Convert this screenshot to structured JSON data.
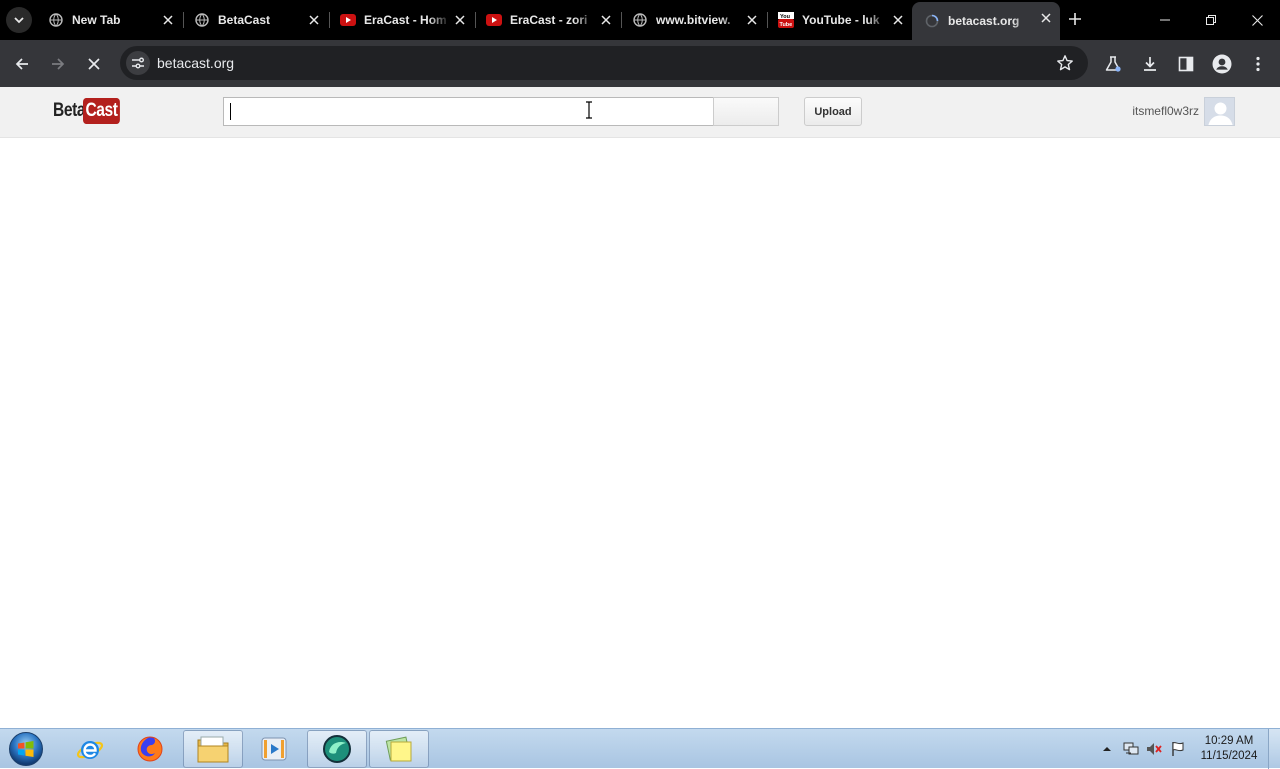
{
  "browser": {
    "tabs": [
      {
        "title": "New Tab",
        "favicon": "globe-icon"
      },
      {
        "title": "BetaCast",
        "favicon": "globe-icon"
      },
      {
        "title": "EraCast - Hom",
        "favicon": "youtube-play-icon"
      },
      {
        "title": "EraCast - zori",
        "favicon": "youtube-play-icon"
      },
      {
        "title": "www.bitview.",
        "favicon": "globe-icon"
      },
      {
        "title": "YouTube - luk",
        "favicon": "youtube-classic-icon"
      },
      {
        "title": "betacast.org",
        "favicon": "loading-icon",
        "active": true
      }
    ],
    "url": "betacast.org"
  },
  "site": {
    "logo_beta": "Beta",
    "logo_cast": "Cast",
    "search_value": "",
    "search_button_label": "",
    "upload_label": "Upload",
    "username": "itsmefl0w3rz"
  },
  "taskbar": {
    "apps": [
      "internet-explorer-icon",
      "firefox-icon",
      "file-explorer-icon",
      "media-player-icon",
      "betacast-app-icon",
      "sticky-notes-icon"
    ],
    "time": "10:29 AM",
    "date": "11/15/2024"
  },
  "colors": {
    "logo_red": "#b3201d",
    "youtube_red": "#cc1111",
    "chrome_dark": "#35363a"
  }
}
